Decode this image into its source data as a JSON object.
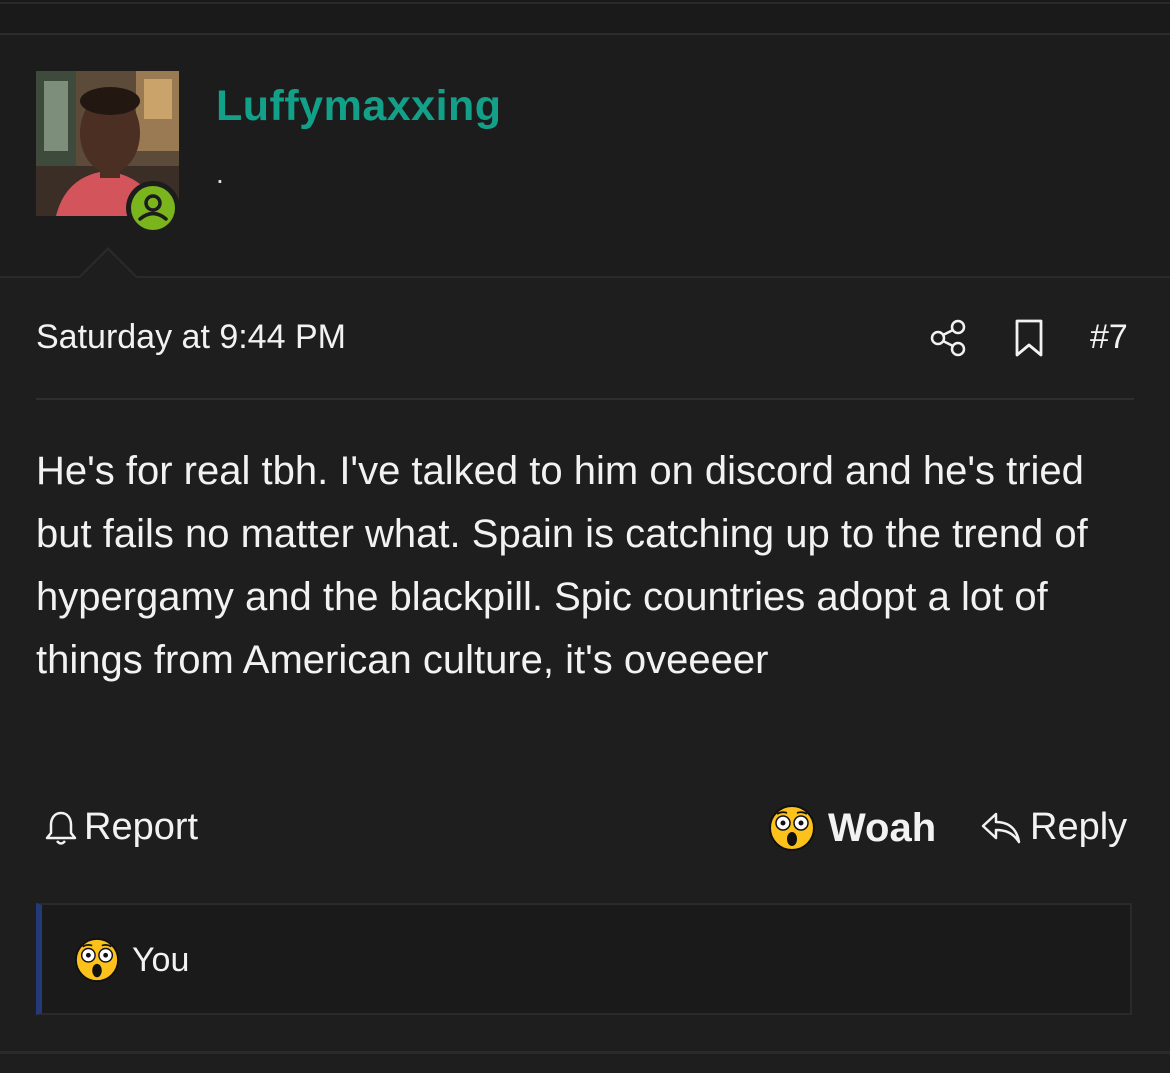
{
  "user": {
    "name": "Luffymaxxing",
    "title": ".",
    "avatar_icon": "avatar-photo",
    "status_icon": "online-user-icon"
  },
  "post": {
    "date": "Saturday at 9:44 PM",
    "number": "#7",
    "share_icon": "share-icon",
    "bookmark_icon": "bookmark-icon",
    "body": "He's for real tbh. I've talked to him on discord and he's tried but fails no matter what. Spain is catching up to the trend of hypergamy and the blackpill. Spic countries adopt a lot of things from American culture, it's oveeeer"
  },
  "actions": {
    "report_label": "Report",
    "reaction_label": "Woah",
    "reply_label": "Reply"
  },
  "reactions_summary": {
    "label": "You"
  },
  "colors": {
    "username": "#13a089",
    "online": "#7ab51d",
    "reaction_bar_accent": "#243a78",
    "background": "#1e1e1e"
  }
}
